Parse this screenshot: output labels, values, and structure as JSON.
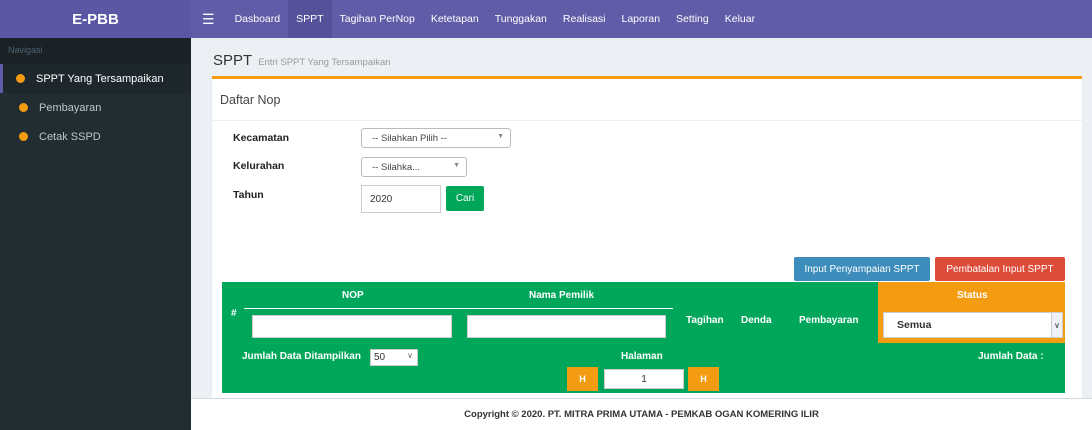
{
  "app": {
    "brand": "E-PBB"
  },
  "topnav": {
    "items": [
      {
        "label": "Dasboard"
      },
      {
        "label": "SPPT"
      },
      {
        "label": "Tagihan PerNop"
      },
      {
        "label": "Ketetapan"
      },
      {
        "label": "Tunggakan"
      },
      {
        "label": "Realisasi"
      },
      {
        "label": "Laporan"
      },
      {
        "label": "Setting"
      },
      {
        "label": "Keluar"
      }
    ],
    "active": "SPPT"
  },
  "sidebar": {
    "header": "Navigasi",
    "items": [
      {
        "label": "SPPT Yang Tersampaikan"
      },
      {
        "label": "Pembayaran"
      },
      {
        "label": "Cetak SSPD"
      }
    ]
  },
  "page": {
    "title": "SPPT",
    "subtitle": "Entri SPPT Yang Tersampaikan"
  },
  "box": {
    "title": "Daftar Nop"
  },
  "form": {
    "kecamatan_label": "Kecamatan",
    "kecamatan_value": "-- Silahkan Pilih --",
    "kelurahan_label": "Kelurahan",
    "kelurahan_value": "-- Silahka...",
    "tahun_label": "Tahun",
    "tahun_value": "2020",
    "cari_label": "Cari"
  },
  "actions": {
    "input_label": "Input Penyampaian SPPT",
    "batal_label": "Pembatalan Input SPPT"
  },
  "table": {
    "headers": {
      "no": "#",
      "nop": "NOP",
      "nama": "Nama Pemilik",
      "tagihan": "Tagihan",
      "denda": "Denda",
      "pembayaran": "Pembayaran",
      "status": "Status"
    },
    "status_value": "Semua",
    "per_page_label": "Jumlah Data Ditampilkan",
    "per_page_value": "50",
    "halaman_label": "Halaman",
    "page_value": "1",
    "jumlah_label": "Jumlah Data :",
    "prev_icon": "H",
    "next_icon": "H"
  },
  "footer": {
    "text": "Copyright © 2020. PT. MITRA PRIMA UTAMA - PEMKAB OGAN KOMERING ILIR"
  },
  "colors": {
    "brand_purple": "#605ca8",
    "sidebar_dark": "#222d32",
    "accent_orange": "#f39c12",
    "table_green": "#00a65a",
    "btn_blue": "#3c8dbc",
    "btn_red": "#dd4b39"
  }
}
